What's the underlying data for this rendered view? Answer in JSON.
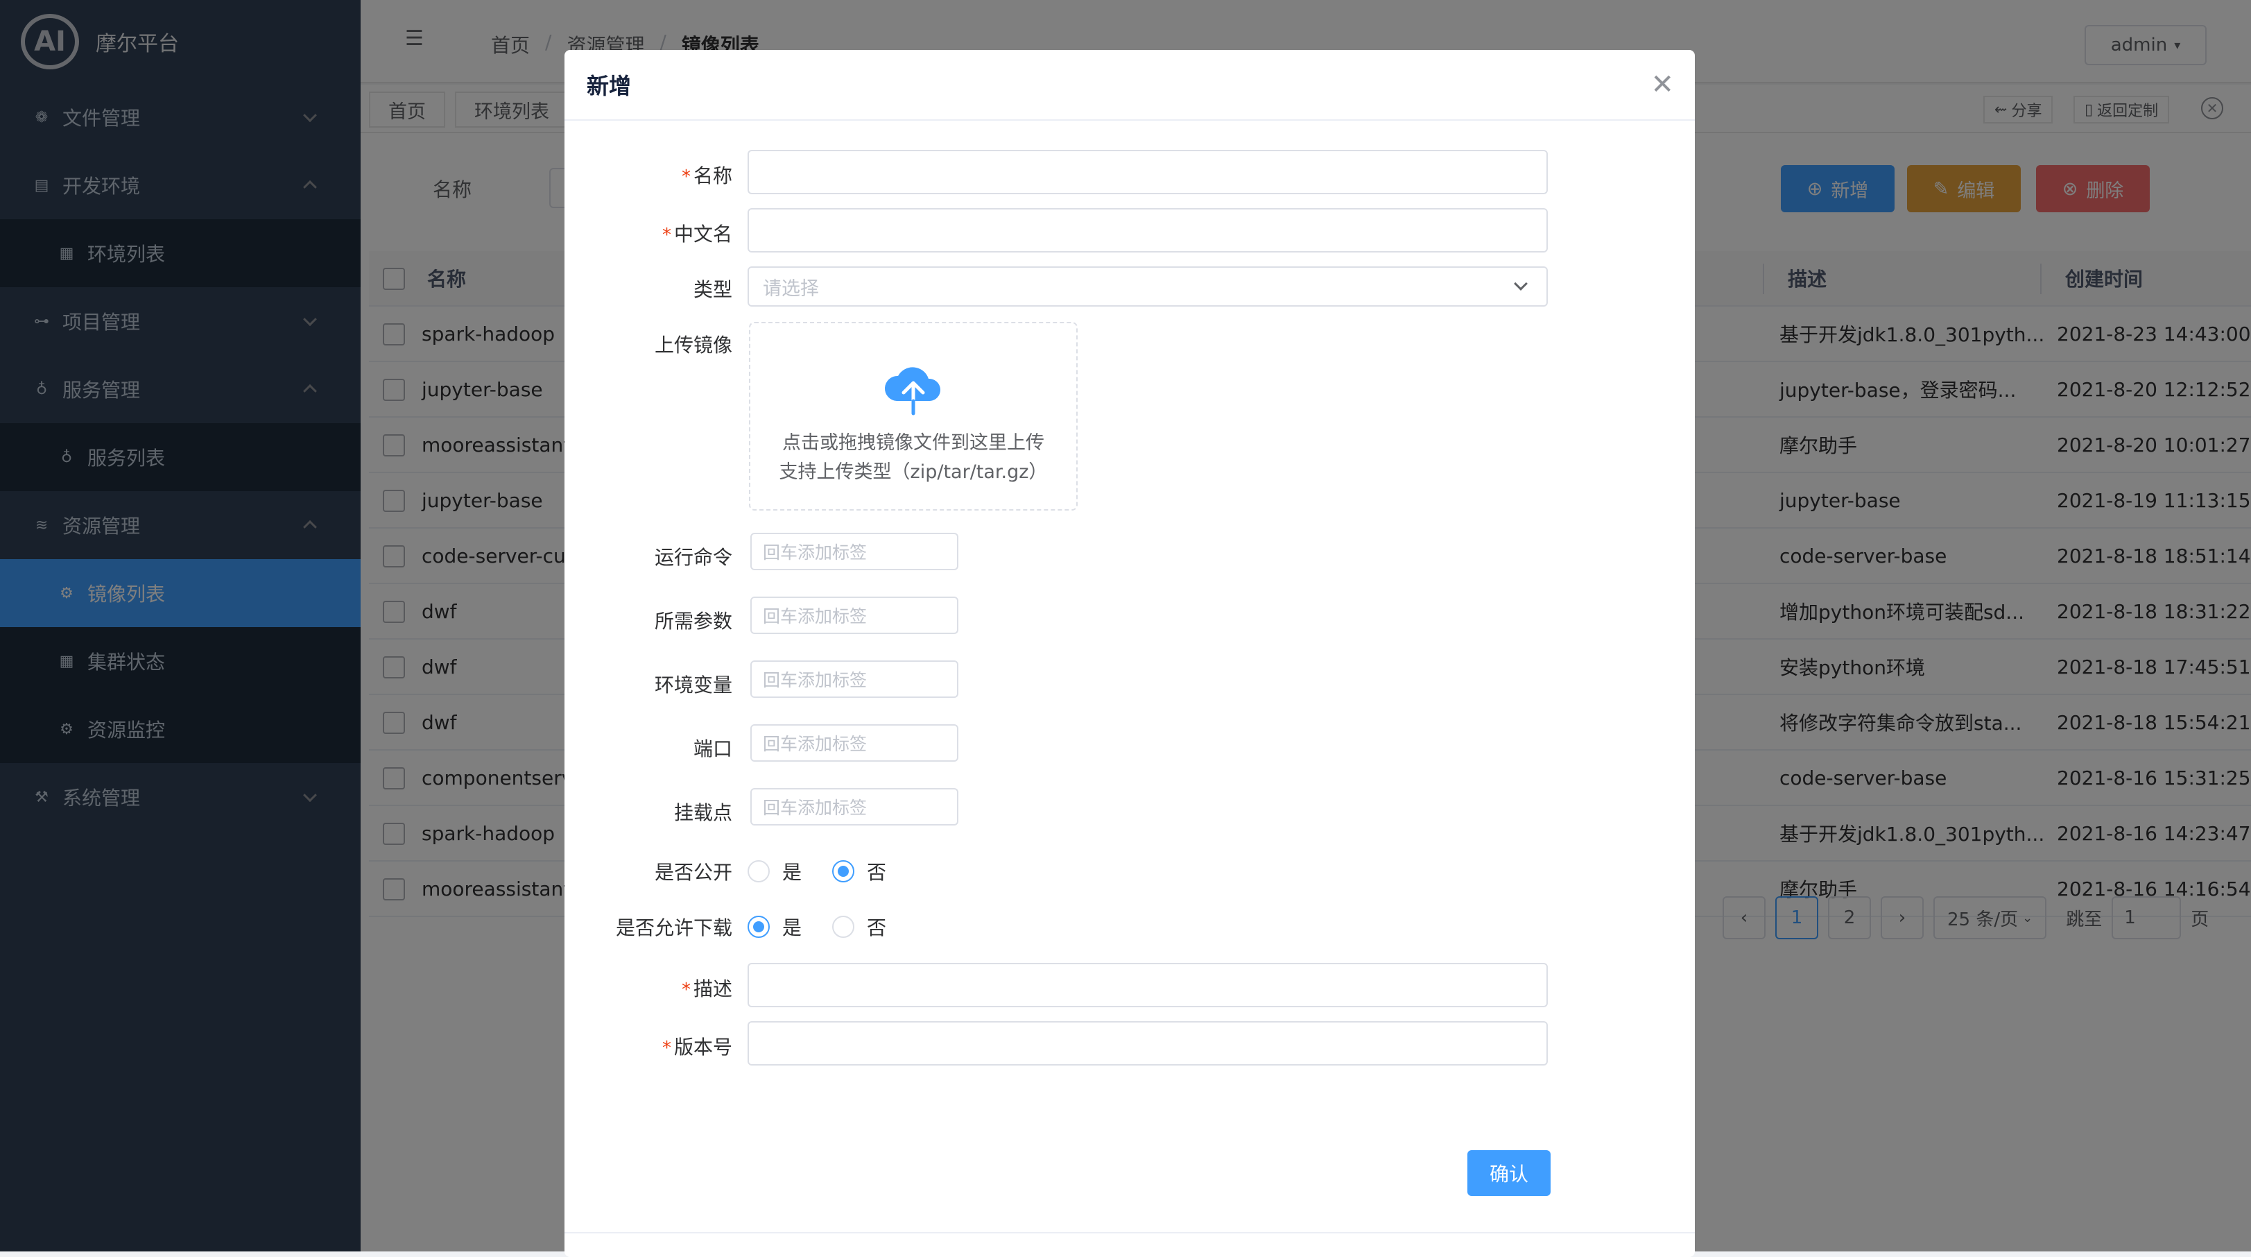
{
  "app": {
    "logo_text": "AI",
    "title": "摩尔平台"
  },
  "sidebar": {
    "items": [
      {
        "label": "文件管理",
        "icon": "folder-icon",
        "expanded": false
      },
      {
        "label": "开发环境",
        "icon": "terminal-icon",
        "expanded": true,
        "children": [
          {
            "label": "环境列表",
            "icon": "list-icon"
          }
        ]
      },
      {
        "label": "项目管理",
        "icon": "project-icon",
        "expanded": false
      },
      {
        "label": "服务管理",
        "icon": "bulb-icon",
        "expanded": true,
        "children": [
          {
            "label": "服务列表",
            "icon": "bulb-icon"
          }
        ]
      },
      {
        "label": "资源管理",
        "icon": "layers-icon",
        "expanded": true,
        "children": [
          {
            "label": "镜像列表",
            "icon": "gear-icon",
            "active": true
          },
          {
            "label": "集群状态",
            "icon": "cluster-icon"
          },
          {
            "label": "资源监控",
            "icon": "monitor-icon"
          }
        ]
      },
      {
        "label": "系统管理",
        "icon": "wrench-icon",
        "expanded": false
      }
    ]
  },
  "header": {
    "breadcrumb": [
      "首页",
      "资源管理",
      "镜像列表"
    ],
    "user": "admin"
  },
  "tags": {
    "items": [
      "首页",
      "环境列表"
    ],
    "share": "分享",
    "back": "返回定制"
  },
  "filter": {
    "label": "名称"
  },
  "actions": {
    "add": "新增",
    "edit": "编辑",
    "delete": "删除"
  },
  "table": {
    "columns": {
      "name": "名称",
      "desc": "描述",
      "time": "创建时间"
    },
    "rows": [
      {
        "name": "spark-hadoop",
        "desc": "基于开发jdk1.8.0_301pyth...",
        "time": "2021-8-23 14:43:00"
      },
      {
        "name": "jupyter-base",
        "desc": "jupyter-base，登录密码...",
        "time": "2021-8-20 12:12:52"
      },
      {
        "name": "mooreassistant",
        "desc": "摩尔助手",
        "time": "2021-8-20 10:01:27"
      },
      {
        "name": "jupyter-base",
        "desc": "jupyter-base",
        "time": "2021-8-19 11:13:15"
      },
      {
        "name": "code-server-cu",
        "desc": "code-server-base",
        "time": "2021-8-18 18:51:14"
      },
      {
        "name": "dwf",
        "desc": "增加python环境可装配sd...",
        "time": "2021-8-18 18:31:22"
      },
      {
        "name": "dwf",
        "desc": "安装python环境",
        "time": "2021-8-18 17:45:51"
      },
      {
        "name": "dwf",
        "desc": "将修改字符集命令放到sta...",
        "time": "2021-8-18 15:54:21"
      },
      {
        "name": "componentserv",
        "desc": "code-server-base",
        "time": "2021-8-16 15:31:25"
      },
      {
        "name": "spark-hadoop",
        "desc": "基于开发jdk1.8.0_301pyth...",
        "time": "2021-8-16 14:23:47"
      },
      {
        "name": "mooreassistant",
        "desc": "摩尔助手",
        "time": "2021-8-16 14:16:54"
      }
    ]
  },
  "pagination": {
    "prev": "‹",
    "pages": [
      "1",
      "2"
    ],
    "current": "1",
    "next": "›",
    "page_size": "25 条/页",
    "jump_label": "跳至",
    "jump_value": "1",
    "page_unit": "页"
  },
  "modal": {
    "title": "新增",
    "fields": {
      "name": "名称",
      "cn_name": "中文名",
      "type": "类型",
      "type_placeholder": "请选择",
      "upload": "上传镜像",
      "upload_text_1": "点击或拖拽镜像文件到这里上传",
      "upload_text_2": "支持上传类型（zip/tar/tar.gz）",
      "run_cmd": "运行命令",
      "params": "所需参数",
      "env": "环境变量",
      "port": "端口",
      "mount": "挂载点",
      "tag_placeholder": "回车添加标签",
      "public": "是否公开",
      "download": "是否允许下载",
      "yes": "是",
      "no": "否",
      "desc": "描述",
      "version": "版本号"
    },
    "public_value": "否",
    "download_value": "是",
    "confirm": "确认",
    "required_mark": "*"
  },
  "colors": {
    "primary": "#409eff",
    "warning": "#e6a23c",
    "danger": "#f56c6c",
    "sidebar": "#304156"
  }
}
